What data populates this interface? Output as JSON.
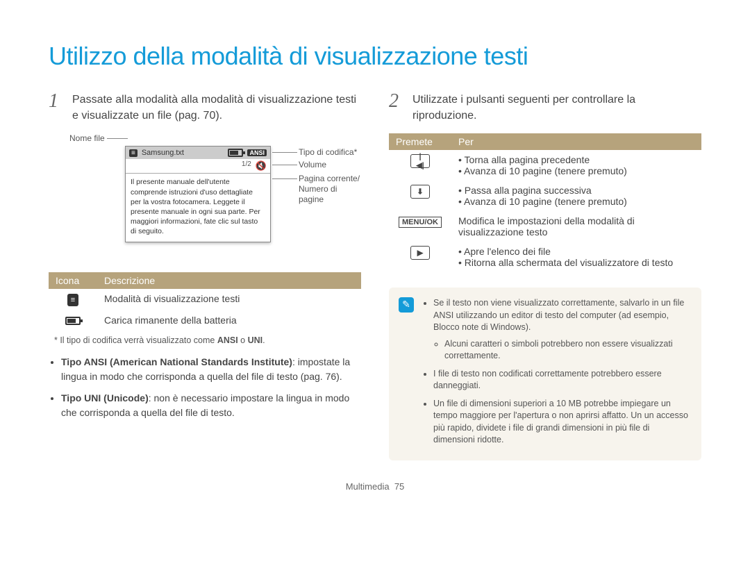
{
  "title": "Utilizzo della modalità di visualizzazione testi",
  "left": {
    "step_num": "1",
    "step_text": "Passate alla modalità alla modalità di visualizzazione testi e visualizzate un file (pag. 70).",
    "diagram": {
      "nome_file": "Nome file",
      "tipo_codifica": "Tipo di codifica*",
      "volume": "Volume",
      "pagina": "Pagina corrente/\nNumero di pagine",
      "filename": "Samsung.txt",
      "page_counter": "1/2",
      "ansi_badge": "ANSI",
      "note_body": "Il presente manuale dell'utente comprende istruzioni d'uso dettagliate per la vostra fotocamera. Leggete il presente manuale in ogni sua parte. Per maggiori informazioni, fate clic sul tasto di seguito."
    },
    "table": {
      "head_icon": "Icona",
      "head_desc": "Descrizione",
      "rows": [
        {
          "desc": "Modalità di visualizzazione testi"
        },
        {
          "desc": "Carica rimanente della batteria"
        }
      ]
    },
    "footnote_prefix": "* Il tipo di codifica verrà visualizzato come ",
    "footnote_a": "ANSI",
    "footnote_mid": " o ",
    "footnote_b": "UNI",
    "footnote_suffix": ".",
    "bullets": [
      {
        "bold": "Tipo ANSI (American National Standards Institute)",
        "rest": ": impostate la lingua in modo che corrisponda a quella del file di testo (pag. 76)."
      },
      {
        "bold": "Tipo UNI (Unicode)",
        "rest": ": non è necessario impostare la lingua in modo che corrisponda a quella del file di testo."
      }
    ]
  },
  "right": {
    "step_num": "2",
    "step_text": "Utilizzate i pulsanti seguenti per controllare la riproduzione.",
    "table": {
      "head_premete": "Premete",
      "head_per": "Per",
      "rows": [
        {
          "icon": "|◀|",
          "per": [
            "Torna alla pagina precedente",
            "Avanza di 10 pagine (tenere premuto)"
          ]
        },
        {
          "icon": "⬇",
          "per": [
            "Passa alla pagina successiva",
            "Avanza di 10 pagine (tenere premuto)"
          ]
        },
        {
          "icon": "MENU/OK",
          "per_plain": "Modifica le impostazioni della modalità di visualizzazione testo"
        },
        {
          "icon": "▶",
          "per": [
            "Apre l'elenco dei file",
            "Ritorna alla schermata del visualizzatore di testo"
          ]
        }
      ]
    },
    "callout": [
      "Se il testo non viene visualizzato correttamente, salvarlo in un file ANSI utilizzando un editor di testo del computer (ad esempio, Blocco note di Windows).",
      "Alcuni caratteri o simboli potrebbero non essere visualizzati correttamente.",
      "I file di testo non codificati correttamente potrebbero essere danneggiati.",
      "Un file di dimensioni superiori a 10 MB potrebbe impiegare un tempo maggiore per l'apertura o non aprirsi affatto. Un un accesso più rapido, dividete i file di grandi dimensioni in più file di dimensioni ridotte."
    ]
  },
  "footer": {
    "section": "Multimedia",
    "page": "75"
  }
}
